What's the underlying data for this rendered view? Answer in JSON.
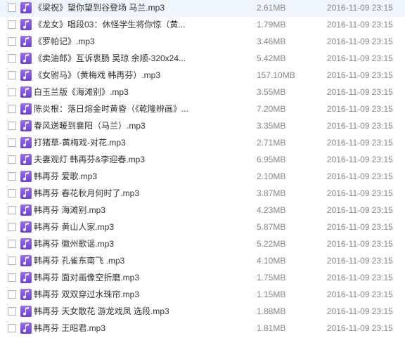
{
  "colors": {
    "icon_fill": "#7b4fe0",
    "text": "#333333",
    "meta_text": "#888888"
  },
  "files": [
    {
      "name": "《梁祝》望你望到谷登场 马兰.mp3",
      "size": "2.61MB",
      "date": "2016-11-09 23:15",
      "icon": "music-file-icon"
    },
    {
      "name": "《龙女》唱段03：休怪学生将你惊（黄...",
      "size": "1.79MB",
      "date": "2016-11-09 23:15",
      "icon": "music-file-icon"
    },
    {
      "name": "《罗帕记》.mp3",
      "size": "3.46MB",
      "date": "2016-11-09 23:15",
      "icon": "music-file-icon"
    },
    {
      "name": "《卖油郎》互诉衷肠 吴琼 余顺-320x24...",
      "size": "5.42MB",
      "date": "2016-11-09 23:15",
      "icon": "music-file-icon"
    },
    {
      "name": "《女驸马》（黄梅戏 韩再芬）.mp3",
      "size": "157.10MB",
      "date": "2016-11-09 23:15",
      "icon": "music-file-icon"
    },
    {
      "name": "白玉兰版《海滩别》.mp3",
      "size": "3.55MB",
      "date": "2016-11-09 23:15",
      "icon": "music-file-icon"
    },
    {
      "name": "陈炎根：落日熔金时黄昏（《乾隆辨画》...",
      "size": "7.20MB",
      "date": "2016-11-09 23:15",
      "icon": "music-file-icon"
    },
    {
      "name": "春风送暖到襄阳（马兰）.mp3",
      "size": "3.35MB",
      "date": "2016-11-09 23:15",
      "icon": "music-file-icon"
    },
    {
      "name": "打猪草-黄梅戏-对花.mp3",
      "size": "2.71MB",
      "date": "2016-11-09 23:15",
      "icon": "music-file-icon"
    },
    {
      "name": "夫妻观灯 韩再芬&李迎春.mp3",
      "size": "6.95MB",
      "date": "2016-11-09 23:15",
      "icon": "music-file-icon"
    },
    {
      "name": "韩再芬 爱歌.mp3",
      "size": "2.10MB",
      "date": "2016-11-09 23:15",
      "icon": "music-file-icon"
    },
    {
      "name": "韩再芬 春花秋月何时了.mp3",
      "size": "3.87MB",
      "date": "2016-11-09 23:15",
      "icon": "music-file-icon"
    },
    {
      "name": "韩再芬 海滩别.mp3",
      "size": "4.23MB",
      "date": "2016-11-09 23:15",
      "icon": "music-file-icon"
    },
    {
      "name": "韩再芬 黄山人家.mp3",
      "size": "5.87MB",
      "date": "2016-11-09 23:15",
      "icon": "music-file-icon"
    },
    {
      "name": "韩再芬 徽州歌谣.mp3",
      "size": "5.22MB",
      "date": "2016-11-09 23:15",
      "icon": "music-file-icon"
    },
    {
      "name": "韩再芬 孔雀东南飞 .mp3",
      "size": "4.10MB",
      "date": "2016-11-09 23:15",
      "icon": "music-file-icon"
    },
    {
      "name": "韩再芬 面对画像空折磨.mp3",
      "size": "1.75MB",
      "date": "2016-11-09 23:15",
      "icon": "music-file-icon"
    },
    {
      "name": "韩再芬 双双穿过水珠帘.mp3",
      "size": "1.15MB",
      "date": "2016-11-09 23:15",
      "icon": "music-file-icon"
    },
    {
      "name": "韩再芬 天女散花 游龙戏凤 选段.mp3",
      "size": "1.88MB",
      "date": "2016-11-09 23:15",
      "icon": "music-file-icon"
    },
    {
      "name": "韩再芬 王昭君.mp3",
      "size": "1.81MB",
      "date": "2016-11-09 23:15",
      "icon": "music-file-icon"
    }
  ]
}
